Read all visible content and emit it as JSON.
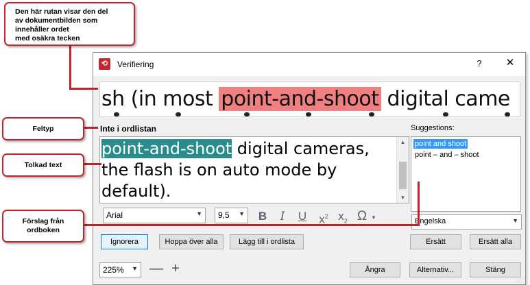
{
  "window": {
    "title": "Verifiering",
    "help_label": "?",
    "close_label": "✕"
  },
  "image_strip": {
    "before": "sh (in most ",
    "highlight": "point-and-shoot",
    "after": " digital came"
  },
  "error_type": "Inte i ordlistan",
  "recognized": {
    "selected": "point-and-shoot",
    "rest_line1": " digital cameras,",
    "line2": "the flash is on auto mode by",
    "line3": "default)."
  },
  "suggestions": {
    "label": "Suggestions:",
    "items": [
      "point and shoot",
      "point – and – shoot"
    ],
    "language": "Engelska"
  },
  "format": {
    "font": "Arial",
    "size": "9,5",
    "bold": "B",
    "italic": "I",
    "underline": "U",
    "sup_base": "x",
    "sup_mark": "2",
    "sub_base": "x",
    "sub_mark": "2",
    "special_char": "Ω"
  },
  "buttons": {
    "ignore": "Ignorera",
    "skip_all": "Hoppa över alla",
    "add_to_dict": "Lägg till i ordlista",
    "replace": "Ersätt",
    "replace_all": "Ersätt alla",
    "undo": "Ångra",
    "options": "Alternativ...",
    "close": "Stäng"
  },
  "zoom": {
    "value": "225%",
    "minus": "—",
    "plus": "+"
  },
  "callouts": {
    "image_area": "Den här rutan visar den del\nav dokumentbilden som\ninnehåller ordet\nmed osäkra tecken",
    "error_type": "Feltyp",
    "recognized_text": "Tolkad text",
    "suggestions": "Förslag från\nordboken"
  },
  "colors": {
    "highlight_image": "#f08080",
    "selection_text": "#2a8c8c",
    "callout_border": "#c0242b",
    "list_selection": "#3399ff"
  },
  "icons": {
    "app": "finereader-icon",
    "dropdown": "chevron-down-icon"
  }
}
